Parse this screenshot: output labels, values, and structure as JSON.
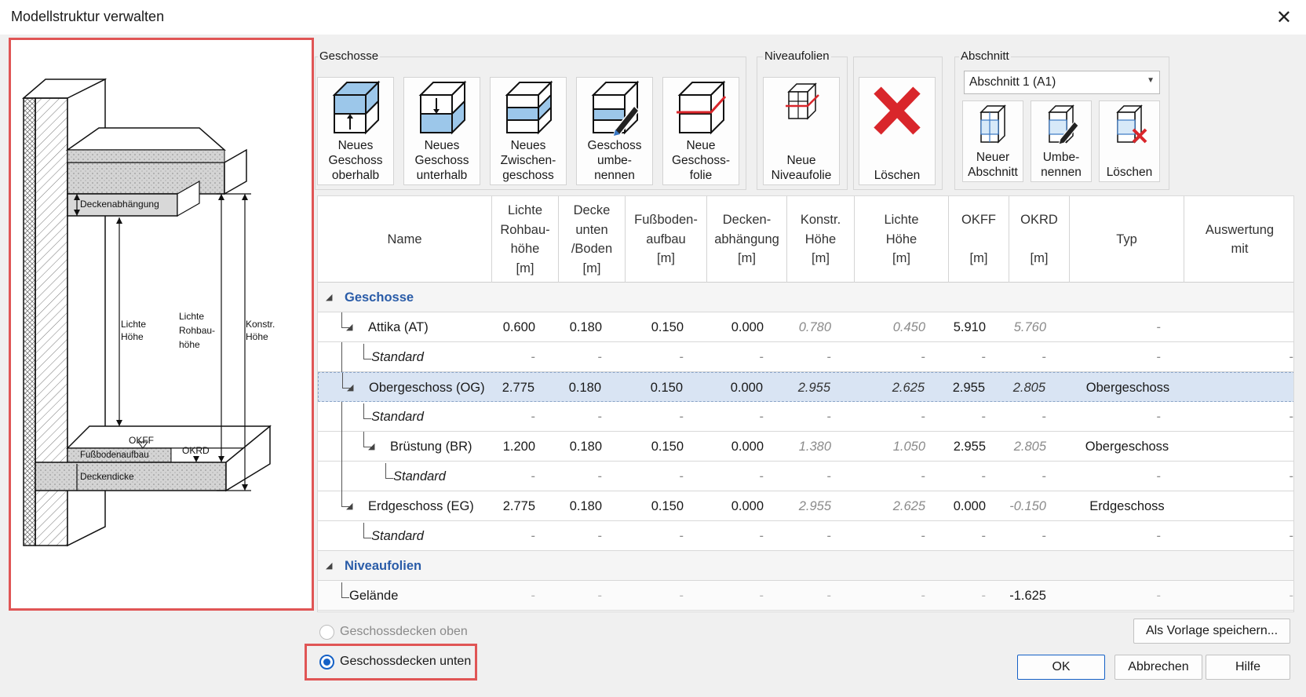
{
  "window": {
    "title": "Modellstruktur verwalten"
  },
  "diagram": {
    "labels": {
      "deckenabhaengung": "Deckenabhängung",
      "lichte_hoehe": "Lichte\nHöhe",
      "lichte_rohbauhoehe": "Lichte\nRohbau-\nhöhe",
      "konstr_hoehe": "Konstr.\nHöhe",
      "okff": "OKFF",
      "okrd": "OKRD",
      "fussbodenaufbau": "Fußbodenaufbau",
      "deckendicke": "Deckendicke"
    }
  },
  "toolbar": {
    "geschosse_group": "Geschosse",
    "niveaufolien_group": "Niveaufolien",
    "abschnitt_group": "Abschnitt",
    "buttons": {
      "neues_oberhalb": "Neues\nGeschoss\noberhalb",
      "neues_unterhalb": "Neues\nGeschoss\nunterhalb",
      "neues_zwischen": "Neues\nZwischen-\ngeschoss",
      "umbenennen": "Geschoss\numbe-\nnennen",
      "neue_folie": "Neue\nGeschoss-\nfolie",
      "neue_niveaufolie": "Neue\nNiveaufolie",
      "loeschen": "Löschen",
      "neuer_abschnitt": "Neuer\nAbschnitt",
      "abschnitt_umbenennen": "Umbe-\nnennen",
      "abschnitt_loeschen": "Löschen"
    },
    "abschnitt_select": "Abschnitt 1 (A1)"
  },
  "table": {
    "headers": [
      "Name",
      "Lichte\nRohbau-\nhöhe\n[m]",
      "Decke\nunten\n/Boden\n[m]",
      "Fußboden-\naufbau\n[m]",
      "Decken-\nabhängung\n[m]",
      "Konstr.\nHöhe\n[m]",
      "Lichte\nHöhe\n[m]",
      "OKFF\n\n[m]",
      "OKRD\n\n[m]",
      "Typ",
      "Auswertung\nmit"
    ],
    "groups": {
      "geschosse": "Geschosse",
      "niveaufolien": "Niveaufolien"
    },
    "rows": [
      {
        "name": "Attika (AT)",
        "values": [
          "0.600",
          "0.180",
          "0.150",
          "0.000",
          "0.780",
          "0.450",
          "5.910",
          "5.760",
          "-",
          ""
        ]
      },
      {
        "name": "Standard",
        "values": [
          "-",
          "-",
          "-",
          "-",
          "-",
          "-",
          "-",
          "-",
          "-",
          "-"
        ]
      },
      {
        "name": "Obergeschoss (OG)",
        "values": [
          "2.775",
          "0.180",
          "0.150",
          "0.000",
          "2.955",
          "2.625",
          "2.955",
          "2.805",
          "Obergeschoss",
          ""
        ]
      },
      {
        "name": "Standard",
        "values": [
          "-",
          "-",
          "-",
          "-",
          "-",
          "-",
          "-",
          "-",
          "-",
          "-"
        ]
      },
      {
        "name": "Brüstung (BR)",
        "values": [
          "1.200",
          "0.180",
          "0.150",
          "0.000",
          "1.380",
          "1.050",
          "2.955",
          "2.805",
          "Obergeschoss",
          ""
        ]
      },
      {
        "name": "Standard",
        "values": [
          "-",
          "-",
          "-",
          "-",
          "-",
          "-",
          "-",
          "-",
          "-",
          "-"
        ]
      },
      {
        "name": "Erdgeschoss (EG)",
        "values": [
          "2.775",
          "0.180",
          "0.150",
          "0.000",
          "2.955",
          "2.625",
          "0.000",
          "-0.150",
          "Erdgeschoss",
          ""
        ]
      },
      {
        "name": "Standard",
        "values": [
          "-",
          "-",
          "-",
          "-",
          "-",
          "-",
          "-",
          "-",
          "-",
          "-"
        ]
      },
      {
        "name": "Gelände",
        "values": [
          "-",
          "-",
          "-",
          "-",
          "-",
          "-",
          "-",
          "-1.625",
          "-",
          "-"
        ]
      }
    ]
  },
  "options": {
    "oben": "Geschossdecken oben",
    "unten": "Geschossdecken unten",
    "selected": "unten"
  },
  "footer": {
    "vorlage": "Als Vorlage speichern...",
    "ok": "OK",
    "abbrechen": "Abbrechen",
    "hilfe": "Hilfe"
  },
  "colors": {
    "accent": "#1460c6",
    "highlight": "#e05555",
    "group_title": "#2a5ca8",
    "selection": "#d9e4f3",
    "delete_red": "#d9262b",
    "cube_blue": "#9cc7ea"
  }
}
